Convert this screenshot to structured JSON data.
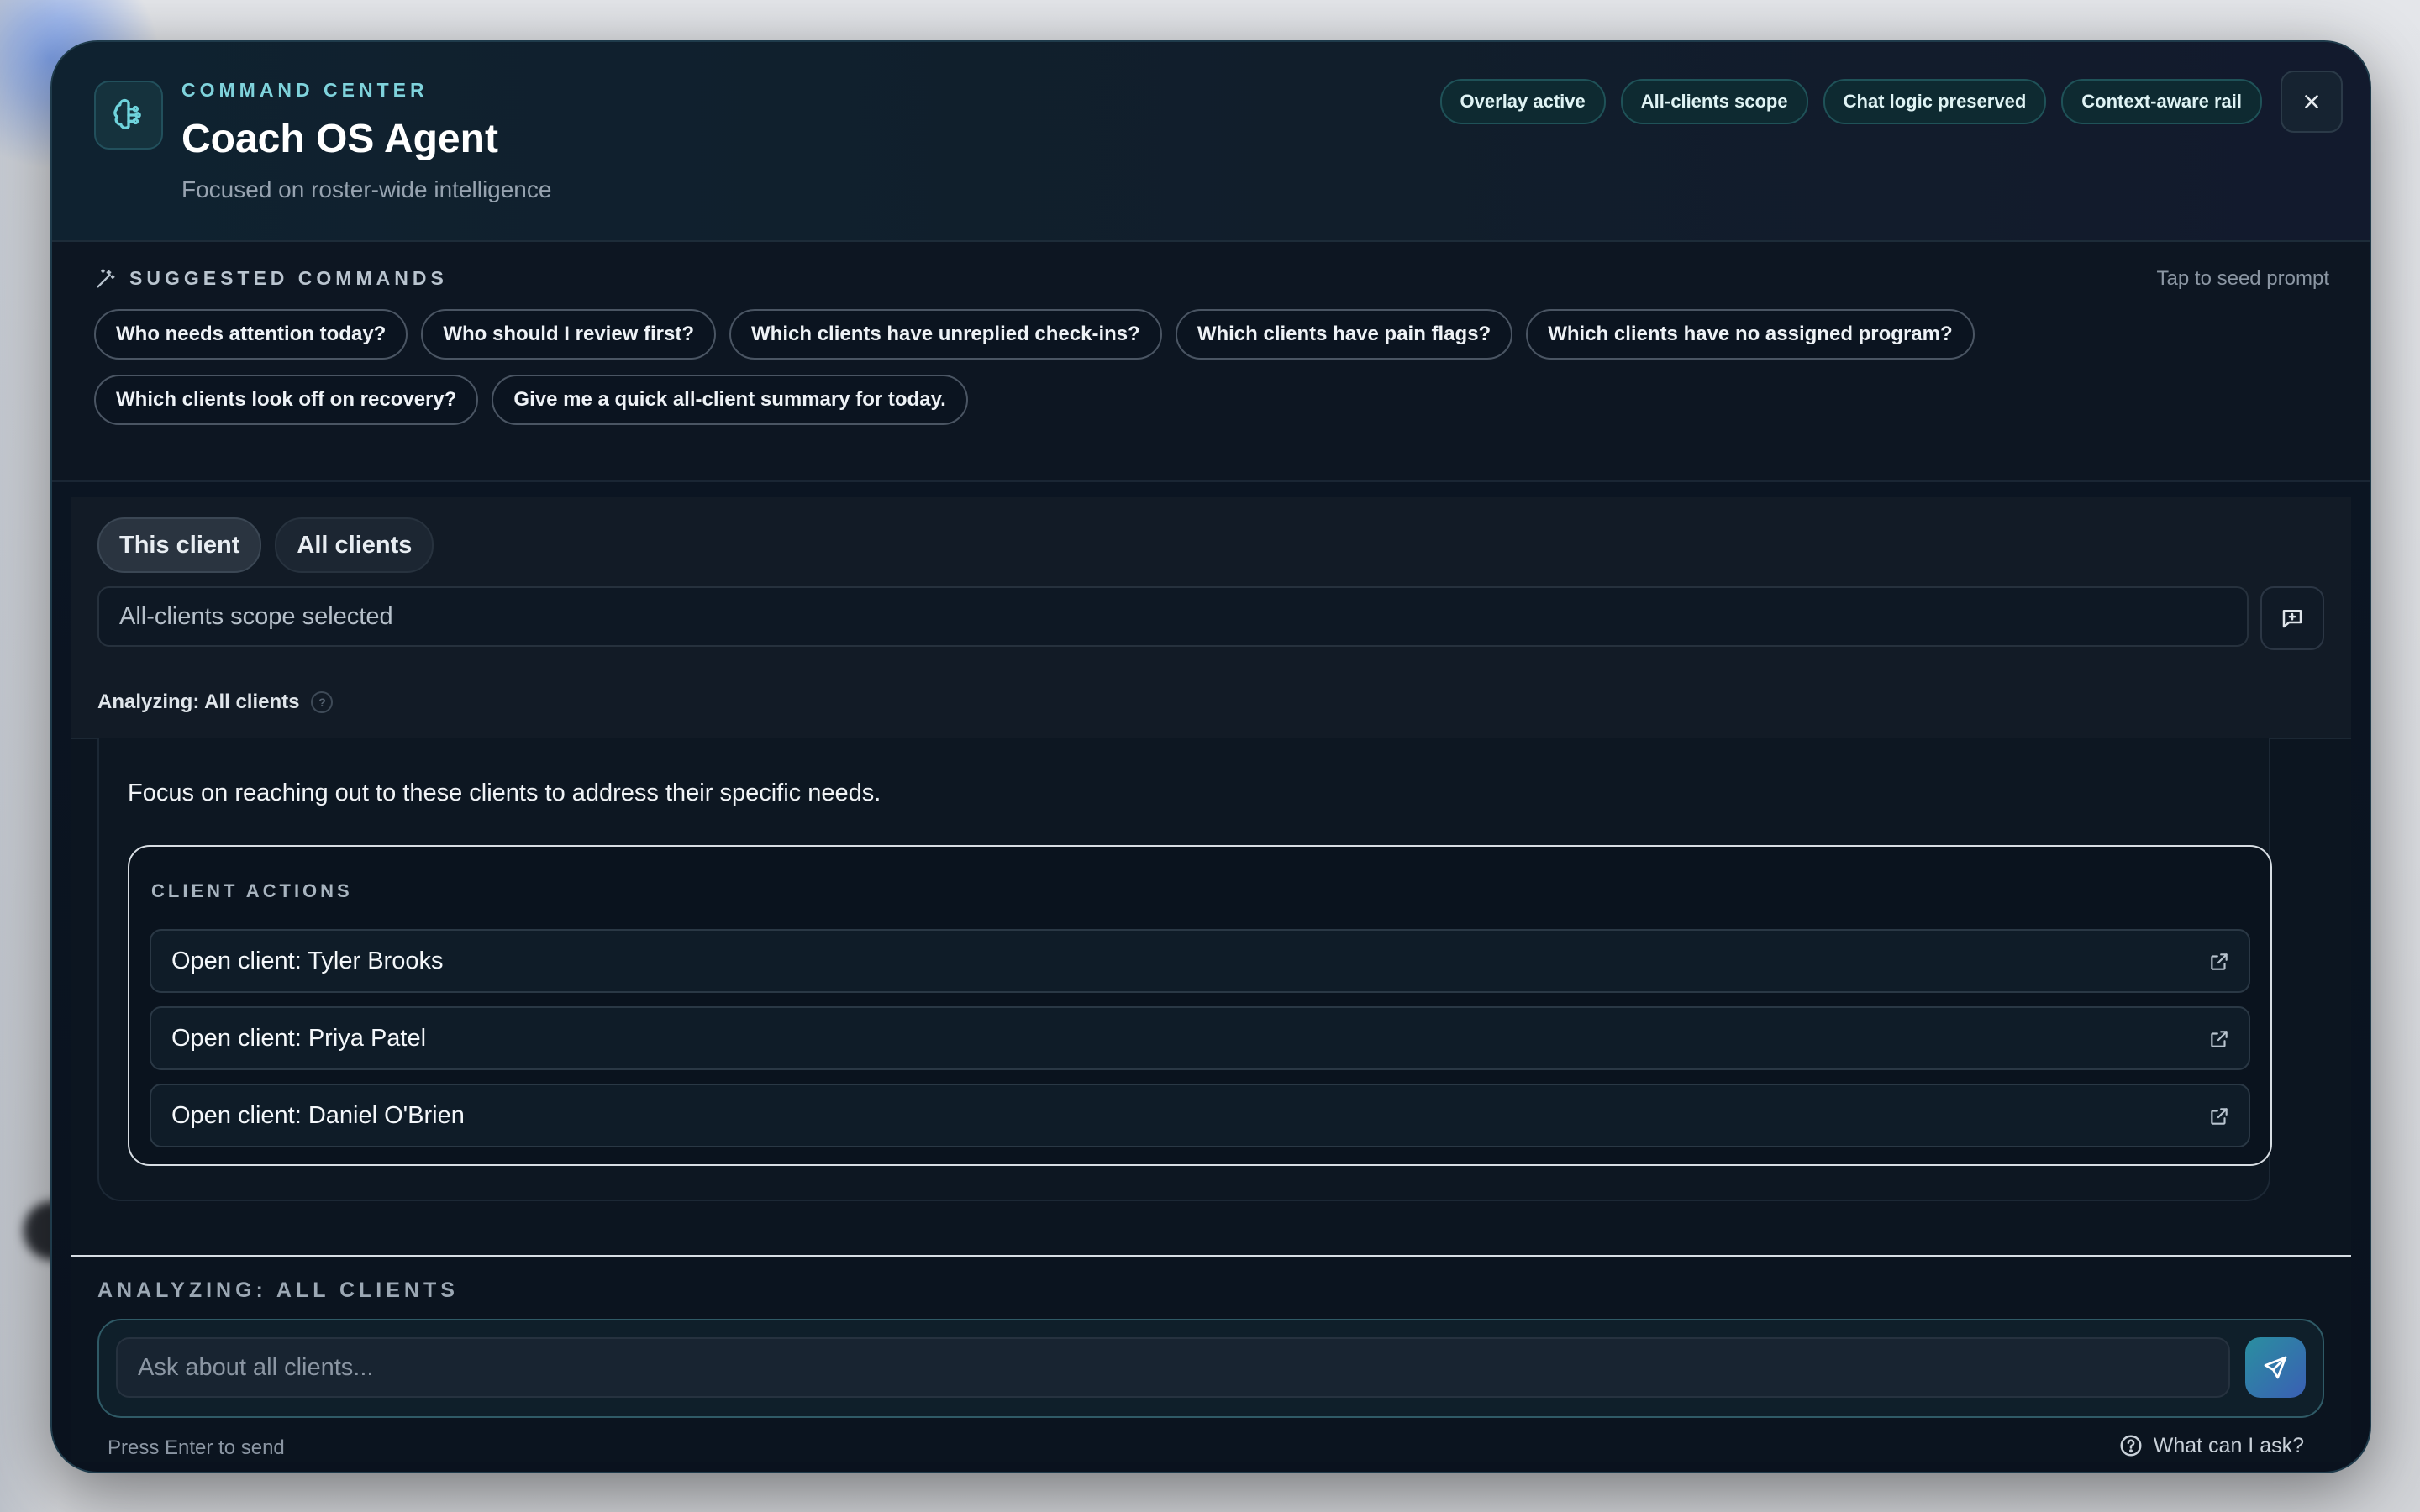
{
  "header": {
    "eyebrow": "COMMAND CENTER",
    "title": "Coach OS Agent",
    "subtitle": "Focused on roster-wide intelligence",
    "badges": [
      "Overlay active",
      "All-clients scope",
      "Chat logic preserved",
      "Context-aware rail"
    ],
    "icon": "brain-icon"
  },
  "commands": {
    "label": "SUGGESTED COMMANDS",
    "hint": "Tap to seed prompt",
    "items": [
      "Who needs attention today?",
      "Who should I review first?",
      "Which clients have unreplied check-ins?",
      "Which clients have pain flags?",
      "Which clients have no assigned program?",
      "Which clients look off on recovery?",
      "Give me a quick all-client summary for today."
    ]
  },
  "scope": {
    "tabs": [
      "This client",
      "All clients"
    ],
    "active_tab": "All clients",
    "field_value": "All-clients scope selected",
    "analyzing": "Analyzing: All clients"
  },
  "message": {
    "text": "Focus on reaching out to these clients to address their specific needs.",
    "actions_label": "CLIENT ACTIONS",
    "actions": [
      "Open client: Tyler Brooks",
      "Open client: Priya Patel",
      "Open client: Daniel O'Brien"
    ]
  },
  "composer": {
    "label": "ANALYZING: ALL CLIENTS",
    "placeholder": "Ask about all clients...",
    "hint": "Press Enter to send",
    "help": "What can I ask?"
  },
  "colors": {
    "accent": "#7fd3dc",
    "panel": "#0c1520",
    "send_gradient_start": "#2a8fa0",
    "send_gradient_end": "#3a5fb4"
  }
}
